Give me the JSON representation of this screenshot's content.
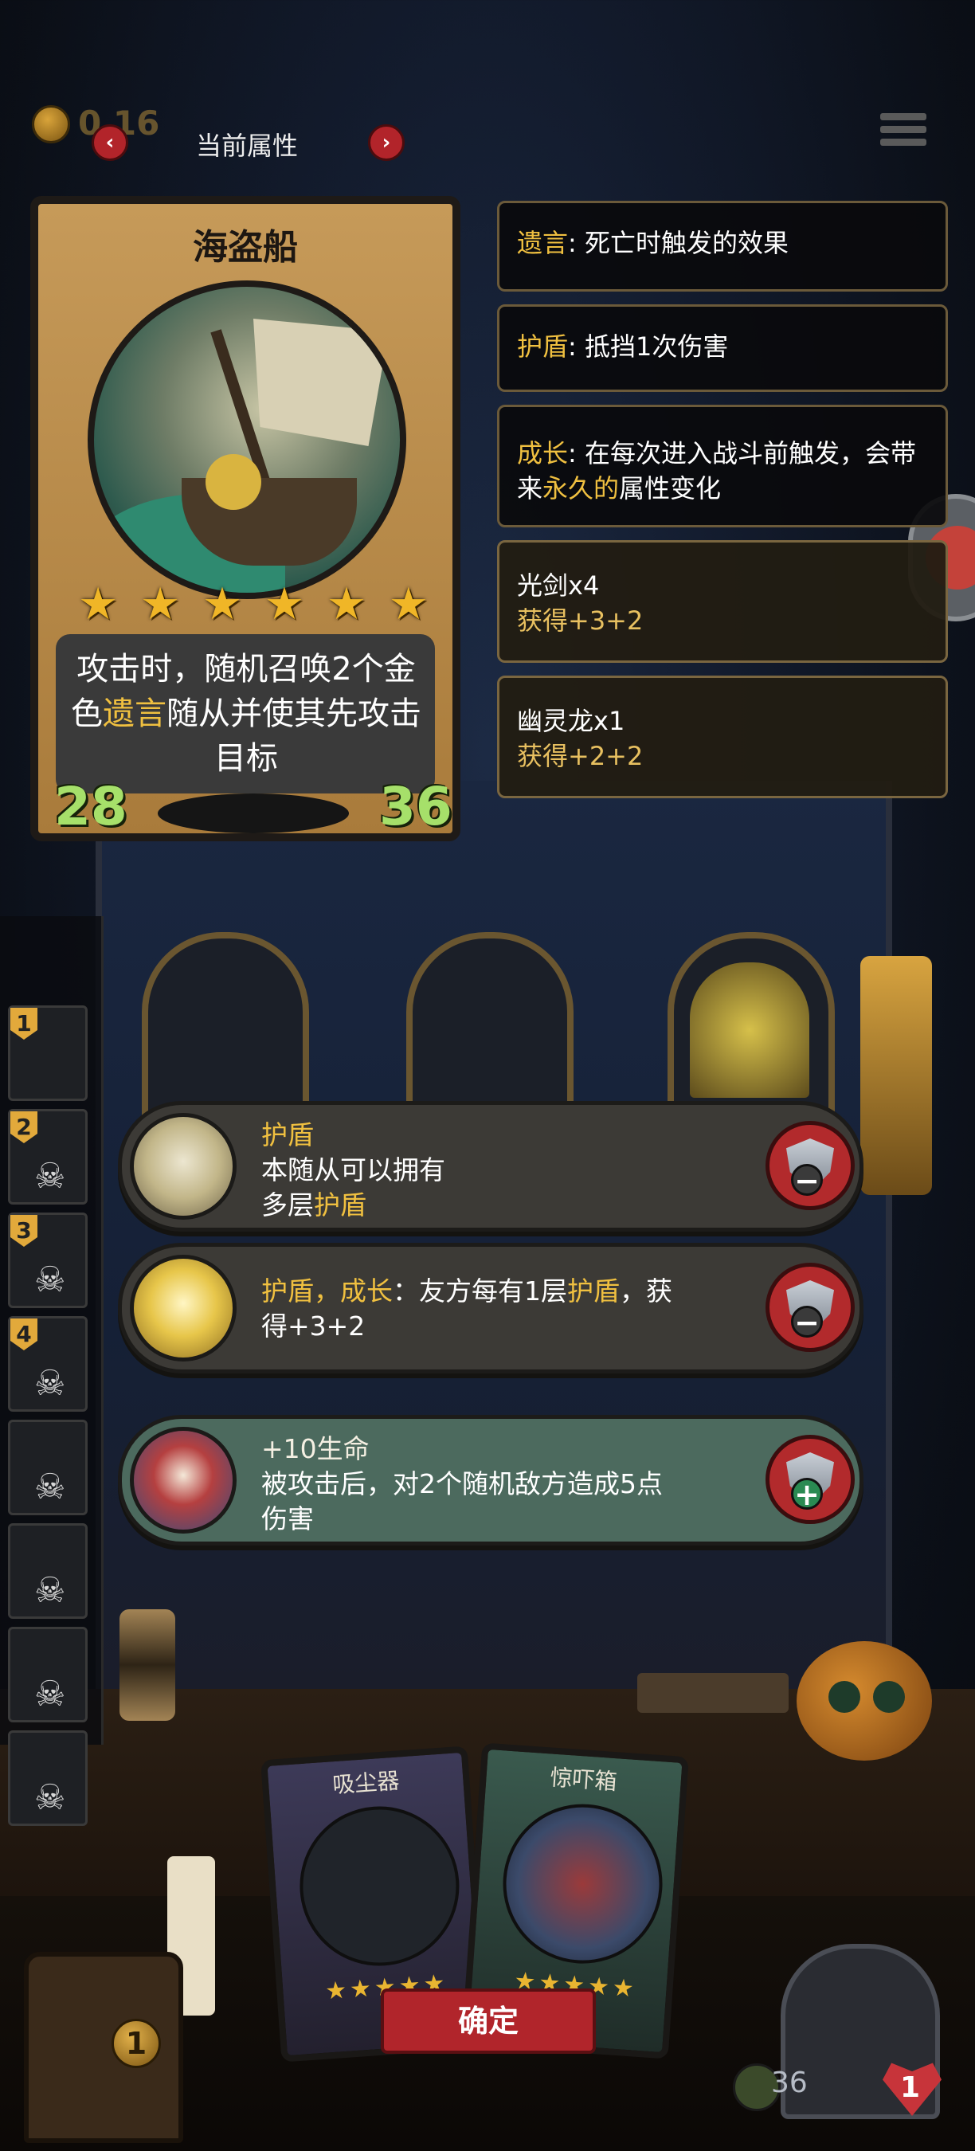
{
  "topbar": {
    "gold": "0 16",
    "title": "当前属性",
    "prev_arrow": "‹",
    "next_arrow": "›"
  },
  "hero_card": {
    "name": "海盗船",
    "stars": 6,
    "description_parts": [
      "攻击时，随机召唤2个金色",
      "遗言",
      "随从并使其先攻击目标"
    ],
    "attack": "28",
    "health": "36"
  },
  "info_panels": [
    {
      "key": "遗言",
      "text": ": 死亡时触发的效果"
    },
    {
      "key": "护盾",
      "text": ": 抵挡1次伤害"
    },
    {
      "key": "成长",
      "text_a": ": 在每次进入战斗前触发，会带来",
      "highlight": "永久的",
      "text_b": "属性变化"
    },
    {
      "line1": "光剑x4",
      "line2": "获得+3+2"
    },
    {
      "line1": "幽灵龙x1",
      "line2": "获得+2+2"
    }
  ],
  "roster": {
    "slots": [
      {
        "num": "1"
      },
      {
        "num": "2"
      },
      {
        "num": "3"
      },
      {
        "num": "4"
      },
      {
        "num": ""
      },
      {
        "num": ""
      },
      {
        "num": ""
      },
      {
        "num": ""
      }
    ]
  },
  "effects": [
    {
      "title": "护盾",
      "line1": "本随从可以拥有",
      "line2_a": "多层",
      "line2_key": "护盾",
      "action": "minus"
    },
    {
      "title": "护盾，成长",
      "line1_a": "：友方每有1层",
      "line1_key": "护盾",
      "line1_b": "，获",
      "line2": "得+3+2",
      "action": "minus"
    },
    {
      "title": "+10生命",
      "line1": "被攻击后，对2个随机敌方造成5点",
      "line2": "伤害",
      "action": "plus"
    }
  ],
  "action_badges": {
    "minus": "−",
    "plus": "+"
  },
  "hand": [
    {
      "name": "吸尘器",
      "stars": "★★★★★"
    },
    {
      "name": "惊吓箱",
      "stars": "★★★★★"
    }
  ],
  "confirm_label": "确定",
  "hud": {
    "chest_coin": "1",
    "health": "36",
    "lives": "1"
  },
  "colors": {
    "accent_gold": "#f0c040",
    "stat_green": "#a6e06a",
    "button_red": "#b1252b"
  }
}
